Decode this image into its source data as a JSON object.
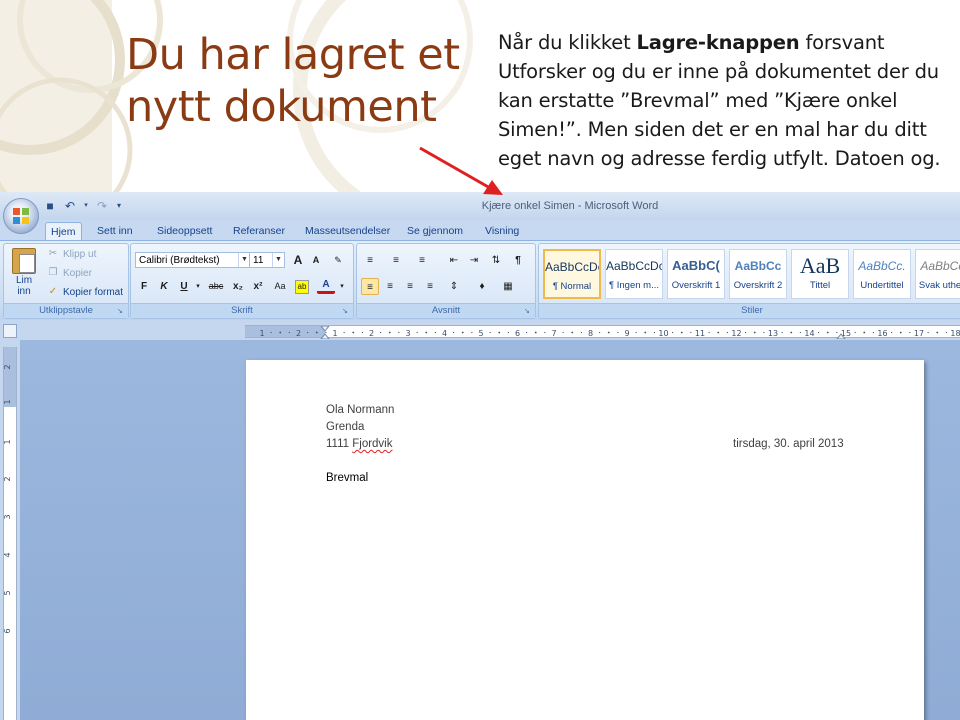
{
  "slide": {
    "title_line1": "Du har lagret et",
    "title_line2": "nytt dokument",
    "body_before_bold": "Når du klikket ",
    "body_bold": "Lagre-knappen",
    "body_after_bold": " forsvant Utforsker og du er inne på dokumentet der du kan erstatte ”Brevmal” med ”Kjære onkel Simen!”. Men siden det er en mal har du ditt eget navn og adresse ferdig utfylt. Datoen og."
  },
  "window": {
    "title": "Kjære onkel Simen - Microsoft Word"
  },
  "tabs": [
    {
      "label": "Hjem"
    },
    {
      "label": "Sett inn"
    },
    {
      "label": "Sideoppsett"
    },
    {
      "label": "Referanser"
    },
    {
      "label": "Masseutsendelser"
    },
    {
      "label": "Se gjennom"
    },
    {
      "label": "Visning"
    }
  ],
  "clipboard": {
    "paste_line1": "Lim",
    "paste_line2": "inn",
    "cut": "Klipp ut",
    "copy": "Kopier",
    "format_painter": "Kopier format",
    "group_label": "Utklippstavle"
  },
  "font": {
    "font_name": "Calibri (Brødtekst)",
    "font_size": "11",
    "grow": "A",
    "shrink": "A",
    "bold": "F",
    "italic": "K",
    "underline": "U",
    "strike": "abc",
    "subscript": "x₂",
    "superscript": "x²",
    "change_case": "Aa",
    "font_color": "A",
    "group_label": "Skrift"
  },
  "paragraph": {
    "group_label": "Avsnitt",
    "pilcrow": "¶"
  },
  "styles": {
    "group_label": "Stiler",
    "items": [
      {
        "preview": "AaBbCcDc",
        "name": "¶ Normal"
      },
      {
        "preview": "AaBbCcDc",
        "name": "¶ Ingen m..."
      },
      {
        "preview": "AaBbC(",
        "name": "Overskrift 1"
      },
      {
        "preview": "AaBbCc",
        "name": "Overskrift 2"
      },
      {
        "preview": "AaB",
        "name": "Tittel"
      },
      {
        "preview": "AaBbCc.",
        "name": "Undertittel"
      },
      {
        "preview": "AaBbCcI",
        "name": "Svak uthe..."
      }
    ]
  },
  "ruler": {
    "labels": [
      "1",
      "2",
      "1",
      "2",
      "3",
      "4",
      "5",
      "6",
      "7",
      "8",
      "9",
      "10",
      "11",
      "12",
      "13",
      "14",
      "15",
      "16",
      "17",
      "18"
    ],
    "vlabels": [
      "2",
      "1",
      "1",
      "2",
      "3",
      "4",
      "5",
      "6"
    ]
  },
  "document": {
    "name": "Ola Normann",
    "street": "Grenda",
    "postcode": "1111",
    "city": "Fjordvik",
    "date": "tirsdag, 30. april 2013",
    "body": "Brevmal"
  },
  "colors": {
    "title_color": "#8a3b14",
    "arrow_color": "#e02020",
    "ribbon_blue": "#c7d9f0"
  }
}
